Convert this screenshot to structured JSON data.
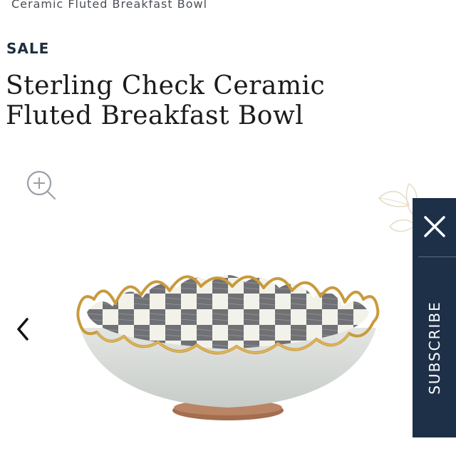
{
  "breadcrumb": {
    "current": "Ceramic Fluted Breakfast Bowl"
  },
  "product": {
    "badge": "SALE",
    "title": "Sterling Check Ceramic Fluted Breakfast Bowl"
  },
  "gallery": {
    "zoom_icon": "zoom-in-icon",
    "prev_icon": "chevron-left-icon"
  },
  "subscribe": {
    "label": "SUBSCRIBE",
    "close_icon": "close-icon",
    "background": "#1e3048"
  },
  "colors": {
    "gold_rim": "#c99a3c",
    "bowl_body": "#d7dbd7",
    "check_dark": "#6f7175",
    "check_light": "#f3f2ea"
  }
}
